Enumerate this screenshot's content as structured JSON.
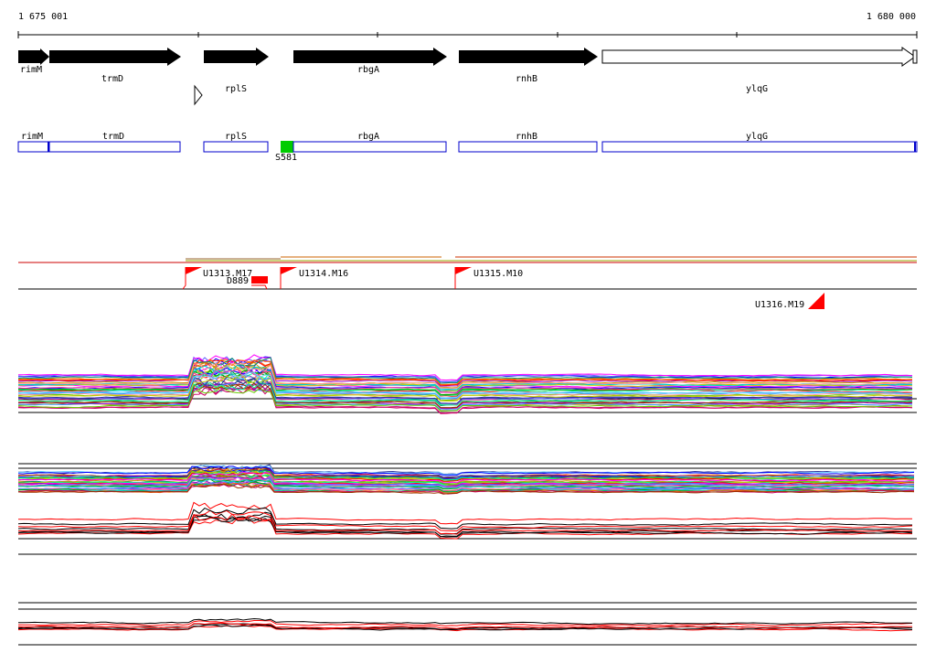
{
  "ruler": {
    "start_label": "1 675 001",
    "end_label": "1 680 000"
  },
  "genes": [
    {
      "name": "rimM",
      "strand": "+",
      "filled": true
    },
    {
      "name": "trmD",
      "strand": "+",
      "filled": true
    },
    {
      "name": "rplS",
      "strand": "+",
      "filled": true
    },
    {
      "name": "rbgA",
      "strand": "+",
      "filled": true
    },
    {
      "name": "rnhB",
      "strand": "+",
      "filled": true
    },
    {
      "name": "ylqG",
      "strand": "+",
      "filled": false
    }
  ],
  "annotation_boxes": [
    "rimM",
    "trmD",
    "rplS",
    "rbgA",
    "rnhB",
    "ylqG"
  ],
  "features": {
    "s_marker": "S581",
    "d_marker": "D889",
    "units": [
      "U1313.M17",
      "U1314.M16",
      "U1315.M10",
      "U1316.M19"
    ]
  },
  "colors": {
    "gene_fill": "#000000",
    "box_stroke": "#0000cc",
    "s_marker": "#00cc00",
    "unit_flag": "#ff0000",
    "track_line": "#000000"
  }
}
